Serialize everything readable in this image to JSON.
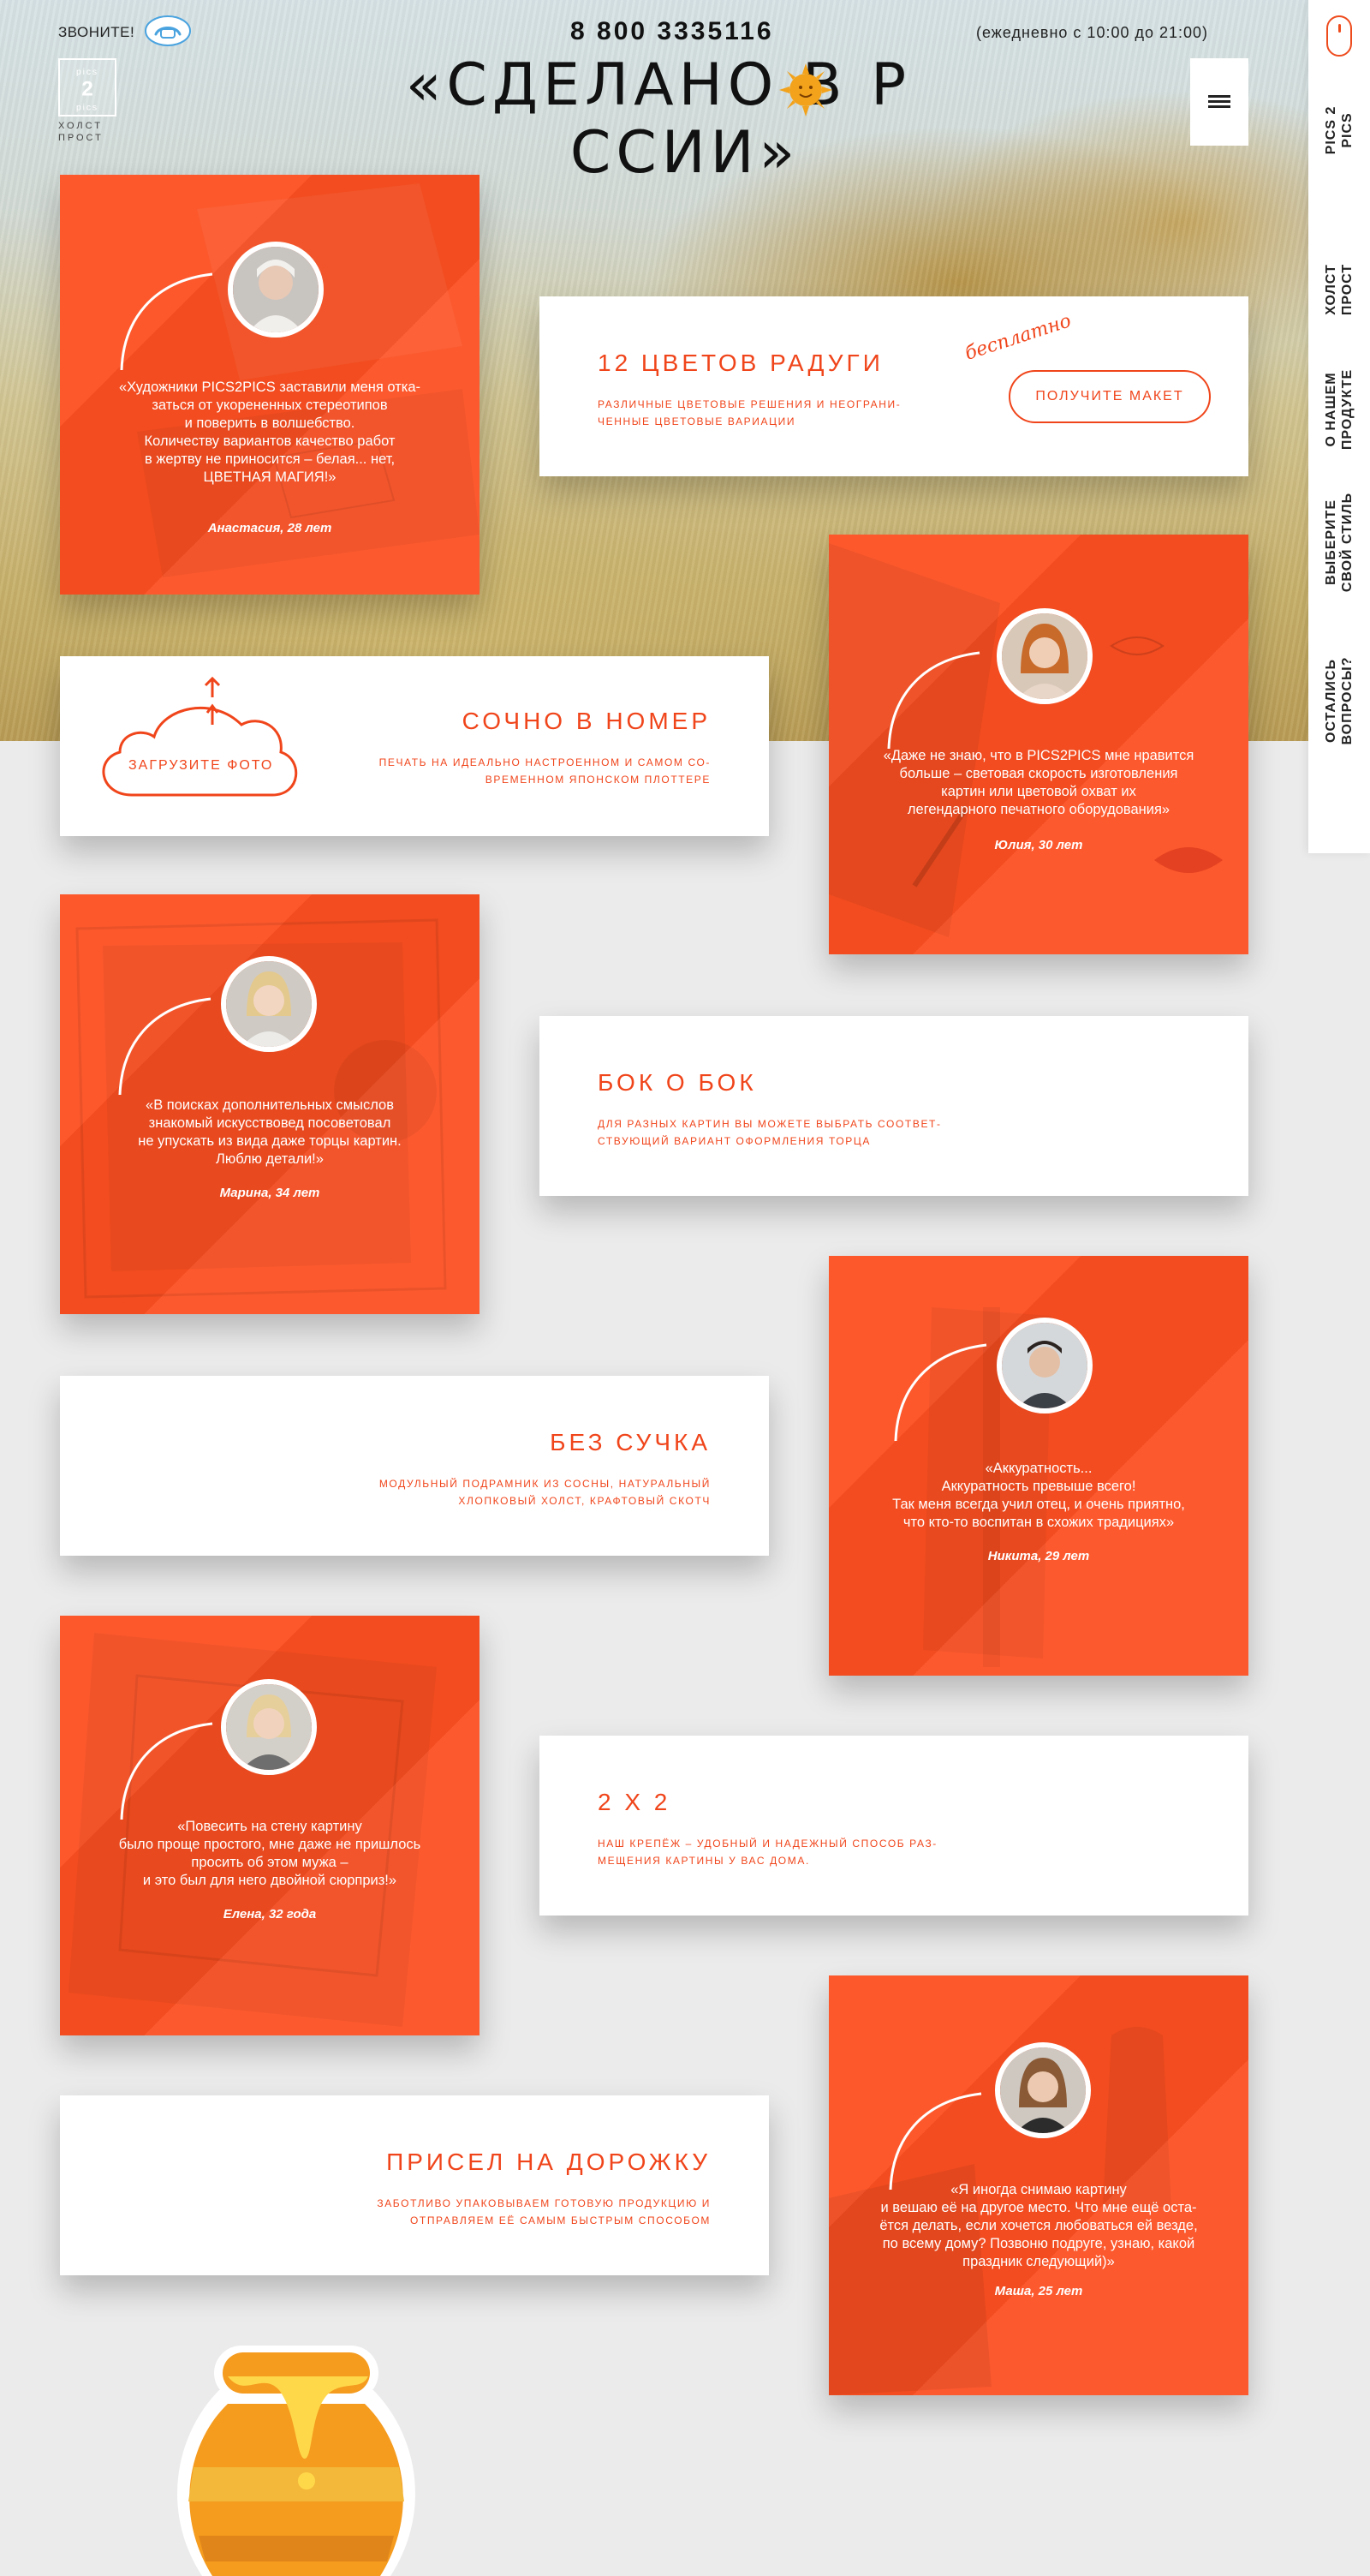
{
  "header": {
    "call_label": "ЗВОНИТЕ!",
    "phone": "8 800 3335116",
    "hours": "(ежедневно с 10:00 до 21:00)",
    "title_left": "«СДЕЛАНО В Р",
    "title_right": "ССИИ»",
    "logo_caption": "ХОЛСТ\nПРОСТ",
    "logo_text": "pics 2 pics"
  },
  "side_nav": {
    "items": [
      {
        "label": "PICS 2\nPICS"
      },
      {
        "label": "ХОЛСТ\nПРОСТ"
      },
      {
        "label": "О НАШЕМ\nПРОДУКТЕ"
      },
      {
        "label": "ВЫБЕРИТЕ\nСВОЙ СТИЛЬ"
      },
      {
        "label": "ОСТАЛИСЬ\nВОПРОСЫ?"
      }
    ]
  },
  "features": {
    "f1": {
      "title": "12 ЦВЕТОВ РАДУГИ",
      "desc": "различные цветовые решения и неограни-\nченные цветовые вариации",
      "free": "бесплатно",
      "button": "ПОЛУЧИТЕ МАКЕТ"
    },
    "f2": {
      "title": "СОЧНО В НОМЕР",
      "desc": "печать на идеально настроенном и самом со-\nвременном японском плоттере",
      "upload": "ЗАГРУЗИТЕ ФОТО"
    },
    "f3": {
      "title": "БОК О БОК",
      "desc": "для разных картин вы можете выбрать соответ-\nствующий вариант оформления торца"
    },
    "f4": {
      "title": "БЕЗ СУЧКА",
      "desc": "модульный подрамник из сосны, натуральный\nхлопковый холст, крафтовый скотч"
    },
    "f5": {
      "title": "2 Х 2",
      "desc": "наш крепёж – удобный  и надежный способ раз-\nмещения картины у вас дома."
    },
    "f6": {
      "title": "ПРИСЕЛ НА ДОРОЖКУ",
      "desc": "заботливо упаковываем готовую продукцию и\nотправляем её самым быстрым способом"
    }
  },
  "reviews": [
    {
      "text": "«Художники PICS2PICS заставили меня отка-\nзаться от укорененных стереотипов\nи поверить в волшебство.\nКоличеству вариантов качество работ\nв жертву не приносится – белая... нет,\nЦВЕТНАЯ МАГИЯ!»",
      "author": "Анастасия, 28 лет"
    },
    {
      "text": "«Даже не знаю, что в PICS2PICS мне нравится\nбольше – световая скорость изготовления\nкартин или цветовой охват их\nлегендарного печатного оборудования»",
      "author": "Юлия, 30 лет"
    },
    {
      "text": "«В поисках дополнительных смыслов\nзнакомый искусствовед посоветовал\nне упускать из вида даже торцы картин.\nЛюблю детали!»",
      "author": "Марина, 34 лет"
    },
    {
      "text": "«Аккуратность...\nАккуратность превыше всего!\nТак меня всегда учил отец, и очень приятно,\nчто кто-то воспитан в схожих традициях»",
      "author": "Никита, 29 лет"
    },
    {
      "text": "«Повесить на стену картину\nбыло проще простого, мне даже не пришлось\nпросить об этом мужа –\nи это был для него двойной сюрприз!»",
      "author": "Елена, 32 года"
    },
    {
      "text": "«Я иногда снимаю картину\nи вешаю её на другое место. Что мне ещё оста-\nётся делать, если хочется любоваться ей везде,\nпо всему дому? Позвоню подруге, узнаю, какой\nпраздник следующий)»",
      "author": "Маша, 25 лет"
    }
  ],
  "colors": {
    "accent": "#f0451b",
    "card_orange": "#fc4f21",
    "page_bg": "#ebebeb"
  }
}
